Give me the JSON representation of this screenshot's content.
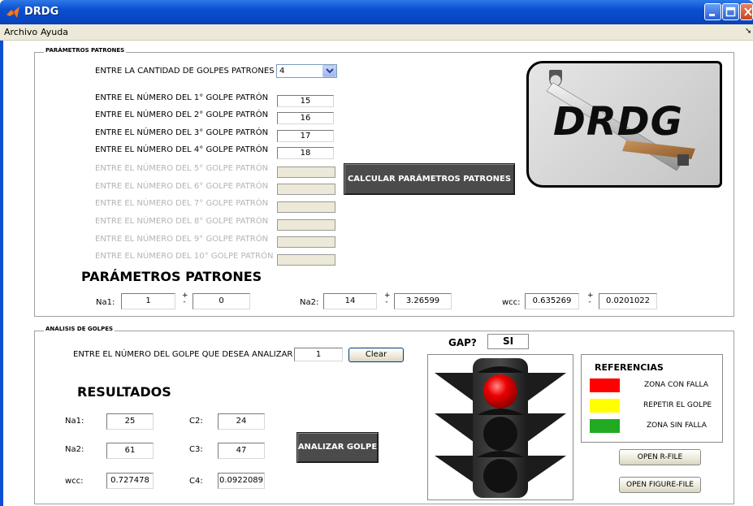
{
  "window": {
    "title": "DRDG"
  },
  "menu": {
    "items": [
      "Archivo",
      "Ayuda"
    ]
  },
  "patrones_panel": {
    "title": "PARÁMETROS PATRONES",
    "cantidad_label": "ENTRE LA CANTIDAD DE GOLPES PATRONES",
    "cantidad_value": "4",
    "golpes": [
      {
        "label": "ENTRE EL NÚMERO DEL 1° GOLPE PATRÓN",
        "value": "15",
        "enabled": true
      },
      {
        "label": "ENTRE EL NÚMERO DEL 2° GOLPE PATRÓN",
        "value": "16",
        "enabled": true
      },
      {
        "label": "ENTRE EL NÚMERO DEL 3° GOLPE PATRÓN",
        "value": "17",
        "enabled": true
      },
      {
        "label": "ENTRE EL NÚMERO DEL 4° GOLPE PATRÓN",
        "value": "18",
        "enabled": true
      },
      {
        "label": "ENTRE EL NÚMERO DEL 5° GOLPE PATRÓN",
        "value": "",
        "enabled": false
      },
      {
        "label": "ENTRE EL NÚMERO DEL 6° GOLPE PATRÓN",
        "value": "",
        "enabled": false
      },
      {
        "label": "ENTRE EL NÚMERO DEL 7° GOLPE PATRÓN",
        "value": "",
        "enabled": false
      },
      {
        "label": "ENTRE EL NÚMERO DEL 8° GOLPE PATRÓN",
        "value": "",
        "enabled": false
      },
      {
        "label": "ENTRE EL NÚMERO DEL 9° GOLPE PATRÓN",
        "value": "",
        "enabled": false
      },
      {
        "label": "ENTRE EL NÚMERO DEL 10° GOLPE PATRÓN",
        "value": "",
        "enabled": false
      }
    ],
    "calcular_button": "CALCULAR PARÁMETROS PATRONES",
    "logo_text": "DRDG",
    "section_title": "PARÁMETROS PATRONES",
    "plus": "+",
    "minus": "-",
    "na1_label": "Na1:",
    "na1_value": "1",
    "na1_dev": "0",
    "na2_label": "Na2:",
    "na2_value": "14",
    "na2_dev": "3.26599",
    "wcc_label": "wcc:",
    "wcc_value": "0.635269",
    "wcc_dev": "0.0201022"
  },
  "analisis_panel": {
    "title": "ANÁLISIS DE GOLPES",
    "golpe_label": "ENTRE EL NÚMERO DEL GOLPE QUE DESEA ANALIZAR",
    "golpe_value": "1",
    "clear_button": "Clear",
    "gap_label": "GAP?",
    "gap_value": "SI",
    "resultados_title": "RESULTADOS",
    "na1_label": "Na1:",
    "na1_value": "25",
    "na2_label": "Na2:",
    "na2_value": "61",
    "wcc_label": "wcc:",
    "wcc_value": "0.727478",
    "c2_label": "C2:",
    "c2_value": "24",
    "c3_label": "C3:",
    "c3_value": "47",
    "c4_label": "C4:",
    "c4_value": "0.0922089",
    "analizar_button": "ANALIZAR GOLPE",
    "traffic_light_active": "red",
    "referencias": {
      "title": "REFERENCIAS",
      "items": [
        {
          "color": "#ff0000",
          "label": "ZONA CON FALLA"
        },
        {
          "color": "#ffff00",
          "label": "REPETIR EL GOLPE"
        },
        {
          "color": "#22aa22",
          "label": "ZONA SIN FALLA"
        }
      ]
    },
    "open_r_button": "OPEN R-FILE",
    "open_figure_button": "OPEN FIGURE-FILE"
  }
}
